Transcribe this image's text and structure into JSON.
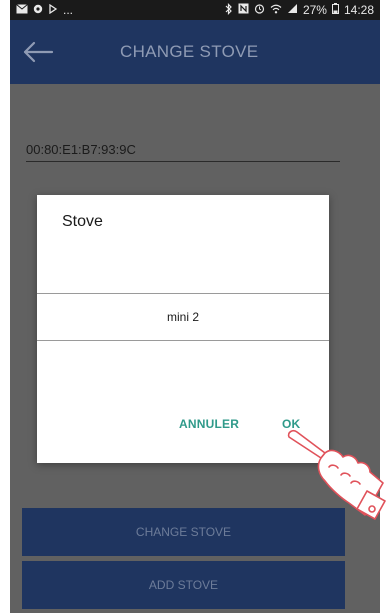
{
  "status_bar": {
    "left_icons": [
      "mail-icon",
      "circle-icon",
      "media-icon"
    ],
    "left_more": "...",
    "right_icons": [
      "bluetooth-icon",
      "nfc-icon",
      "alarm-icon",
      "wifi-icon",
      "signal-icon"
    ],
    "battery": "27%",
    "time": "14:28"
  },
  "app_bar": {
    "title": "CHANGE STOVE",
    "back_icon": "arrow-left-icon"
  },
  "mac_field": {
    "value": "00:80:E1:B7:93:9C"
  },
  "dialog": {
    "title": "Stove",
    "selected_value": "mini 2",
    "cancel_label": "ANNULER",
    "ok_label": "OK"
  },
  "buttons": {
    "change_stove": "CHANGE STOVE",
    "add_stove": "ADD STOVE"
  },
  "colors": {
    "app_bar": "#1f3560",
    "overlay": "#616161",
    "dialog_button": "#2f9a8a"
  }
}
